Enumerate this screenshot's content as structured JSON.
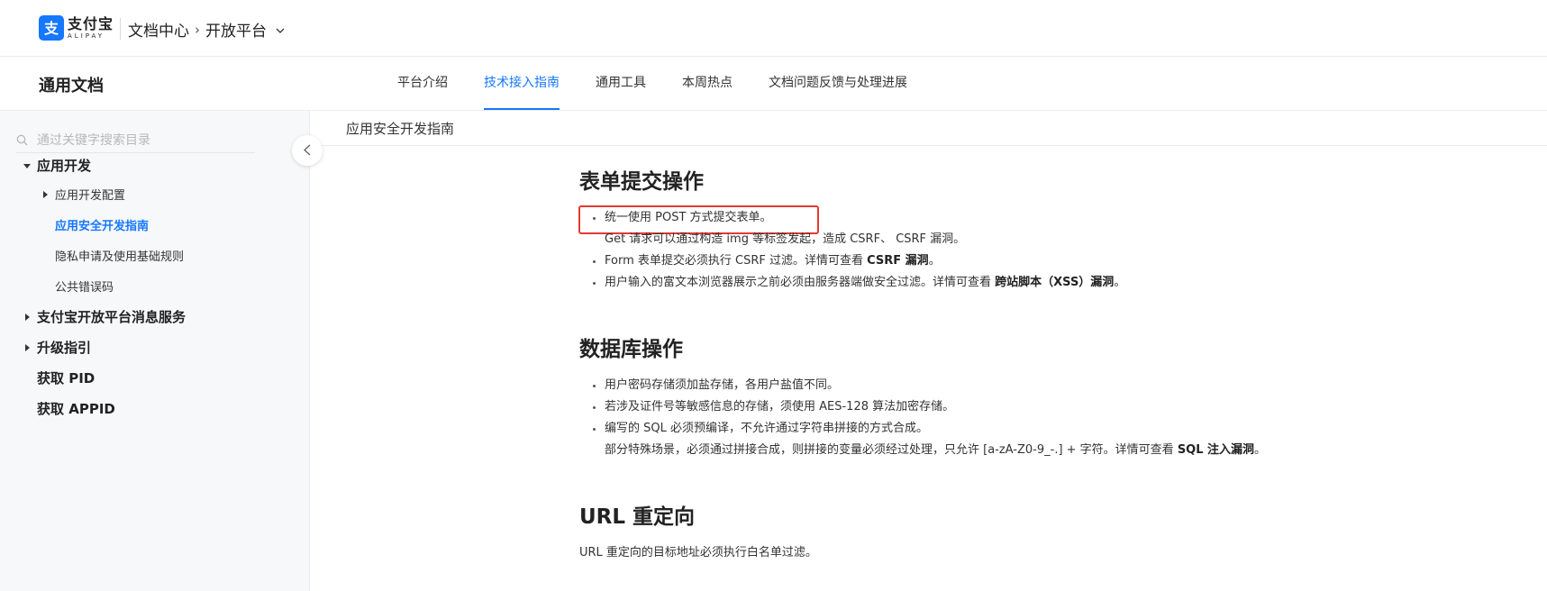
{
  "header": {
    "logo_cn": "支付宝",
    "logo_en": "ALIPAY",
    "breadcrumb": [
      "文档中心",
      "开放平台"
    ]
  },
  "secnav": {
    "title": "通用文档",
    "tabs": [
      {
        "label": "平台介绍",
        "active": false
      },
      {
        "label": "技术接入指南",
        "active": true
      },
      {
        "label": "通用工具",
        "active": false
      },
      {
        "label": "本周热点",
        "active": false
      },
      {
        "label": "文档问题反馈与处理进展",
        "active": false
      }
    ]
  },
  "sidebar": {
    "search_placeholder": "通过关键字搜索目录",
    "items": [
      {
        "label": "应用开发"
      },
      {
        "label": "应用开发配置"
      },
      {
        "label": "应用安全开发指南"
      },
      {
        "label": "隐私申请及使用基础规则"
      },
      {
        "label": "公共错误码"
      },
      {
        "label": "支付宝开放平台消息服务"
      },
      {
        "label": "升级指引"
      },
      {
        "label": "获取 PID"
      },
      {
        "label": "获取 APPID"
      }
    ]
  },
  "content": {
    "page_title": "应用安全开发指南",
    "sections": [
      {
        "heading": "表单提交操作",
        "b1": "统一使用 POST 方式提交表单。",
        "b1_sub": "Get 请求可以通过构造 img 等标签发起，造成 CSRF、 CSRF 漏洞。",
        "b2_text": "Form 表单提交必须执行 CSRF 过滤。详情可查看 ",
        "b2_link": "CSRF 漏洞",
        "b2_end": "。",
        "b3_text": "用户输入的富文本浏览器展示之前必须由服务器端做安全过滤。详情可查看 ",
        "b3_link": "跨站脚本（XSS）漏洞",
        "b3_end": "。"
      },
      {
        "heading": "数据库操作",
        "b1": "用户密码存储须加盐存储，各用户盐值不同。",
        "b2": "若涉及证件号等敏感信息的存储，须使用 AES-128 算法加密存储。",
        "b3": "编写的 SQL 必须预编译，不允许通过字符串拼接的方式合成。",
        "b3_sub_text": "部分特殊场景，必须通过拼接合成，则拼接的变量必须经过处理，只允许 [a-zA-Z0-9_-.] + 字符。详情可查看 ",
        "b3_sub_link": "SQL 注入漏洞",
        "b3_sub_end": "。"
      },
      {
        "heading": "URL 重定向",
        "text": "URL 重定向的目标地址必须执行白名单过滤。"
      }
    ]
  },
  "colors": {
    "brand": "#1677ff",
    "highlight": "#e53935"
  }
}
